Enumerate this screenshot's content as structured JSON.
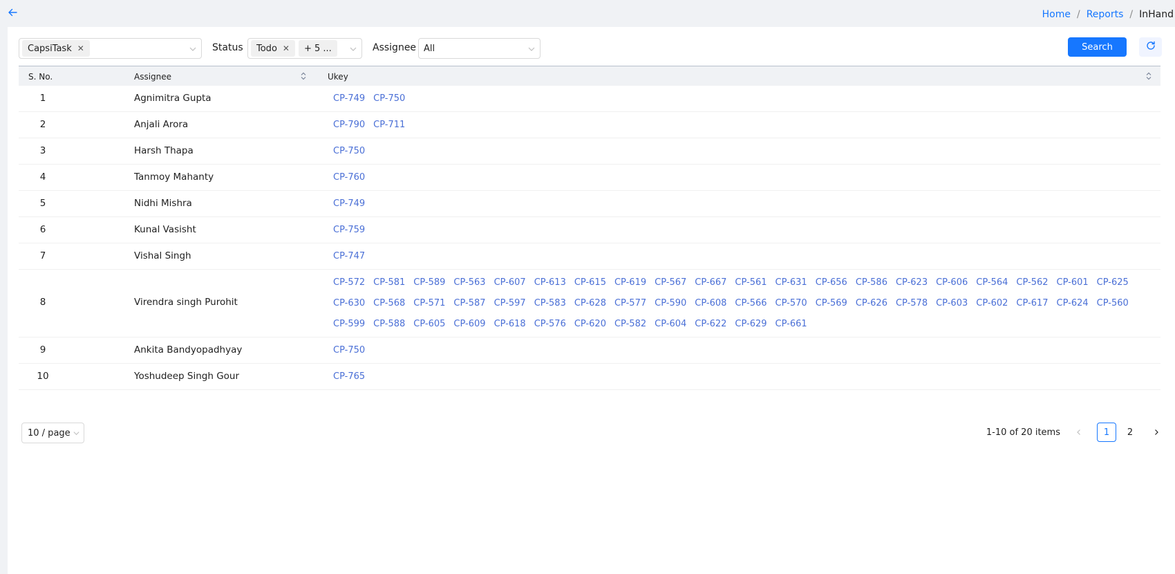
{
  "breadcrumb": {
    "home": "Home",
    "reports": "Reports",
    "current": "InHand",
    "sep1": "/",
    "sep2": "/"
  },
  "filters": {
    "project": {
      "tag": "CapsiTask"
    },
    "status": {
      "label": "Status",
      "tag": "Todo",
      "more": "+ 5 ..."
    },
    "assignee": {
      "label": "Assignee",
      "value": "All"
    }
  },
  "buttons": {
    "search": "Search"
  },
  "table": {
    "headers": {
      "sno": "S. No.",
      "assignee": "Assignee",
      "ukey": "Ukey"
    },
    "rows": [
      {
        "sno": "1",
        "name": "Agnimitra Gupta",
        "keys": [
          "CP-749",
          "CP-750"
        ]
      },
      {
        "sno": "2",
        "name": "Anjali Arora",
        "keys": [
          "CP-790",
          "CP-711"
        ]
      },
      {
        "sno": "3",
        "name": "Harsh Thapa",
        "keys": [
          "CP-750"
        ]
      },
      {
        "sno": "4",
        "name": "Tanmoy Mahanty",
        "keys": [
          "CP-760"
        ]
      },
      {
        "sno": "5",
        "name": "Nidhi Mishra",
        "keys": [
          "CP-749"
        ]
      },
      {
        "sno": "6",
        "name": "Kunal Vasisht",
        "keys": [
          "CP-759"
        ]
      },
      {
        "sno": "7",
        "name": "Vishal Singh",
        "keys": [
          "CP-747"
        ]
      },
      {
        "sno": "8",
        "name": "Virendra singh Purohit",
        "keys": [
          "CP-572",
          "CP-581",
          "CP-589",
          "CP-563",
          "CP-607",
          "CP-613",
          "CP-615",
          "CP-619",
          "CP-567",
          "CP-667",
          "CP-561",
          "CP-631",
          "CP-656",
          "CP-586",
          "CP-623",
          "CP-606",
          "CP-564",
          "CP-562",
          "CP-601",
          "CP-625",
          "CP-630",
          "CP-568",
          "CP-571",
          "CP-587",
          "CP-597",
          "CP-583",
          "CP-628",
          "CP-577",
          "CP-590",
          "CP-608",
          "CP-566",
          "CP-570",
          "CP-569",
          "CP-626",
          "CP-578",
          "CP-603",
          "CP-602",
          "CP-617",
          "CP-624",
          "CP-560",
          "CP-599",
          "CP-588",
          "CP-605",
          "CP-609",
          "CP-618",
          "CP-576",
          "CP-620",
          "CP-582",
          "CP-604",
          "CP-622",
          "CP-629",
          "CP-661"
        ]
      },
      {
        "sno": "9",
        "name": "Ankita Bandyopadhyay",
        "keys": [
          "CP-750"
        ]
      },
      {
        "sno": "10",
        "name": "Yoshudeep Singh Gour",
        "keys": [
          "CP-765"
        ]
      }
    ]
  },
  "pagination": {
    "page_size": "10 / page",
    "total": "1-10 of 20 items",
    "pages": [
      "1",
      "2"
    ],
    "current": "1"
  }
}
